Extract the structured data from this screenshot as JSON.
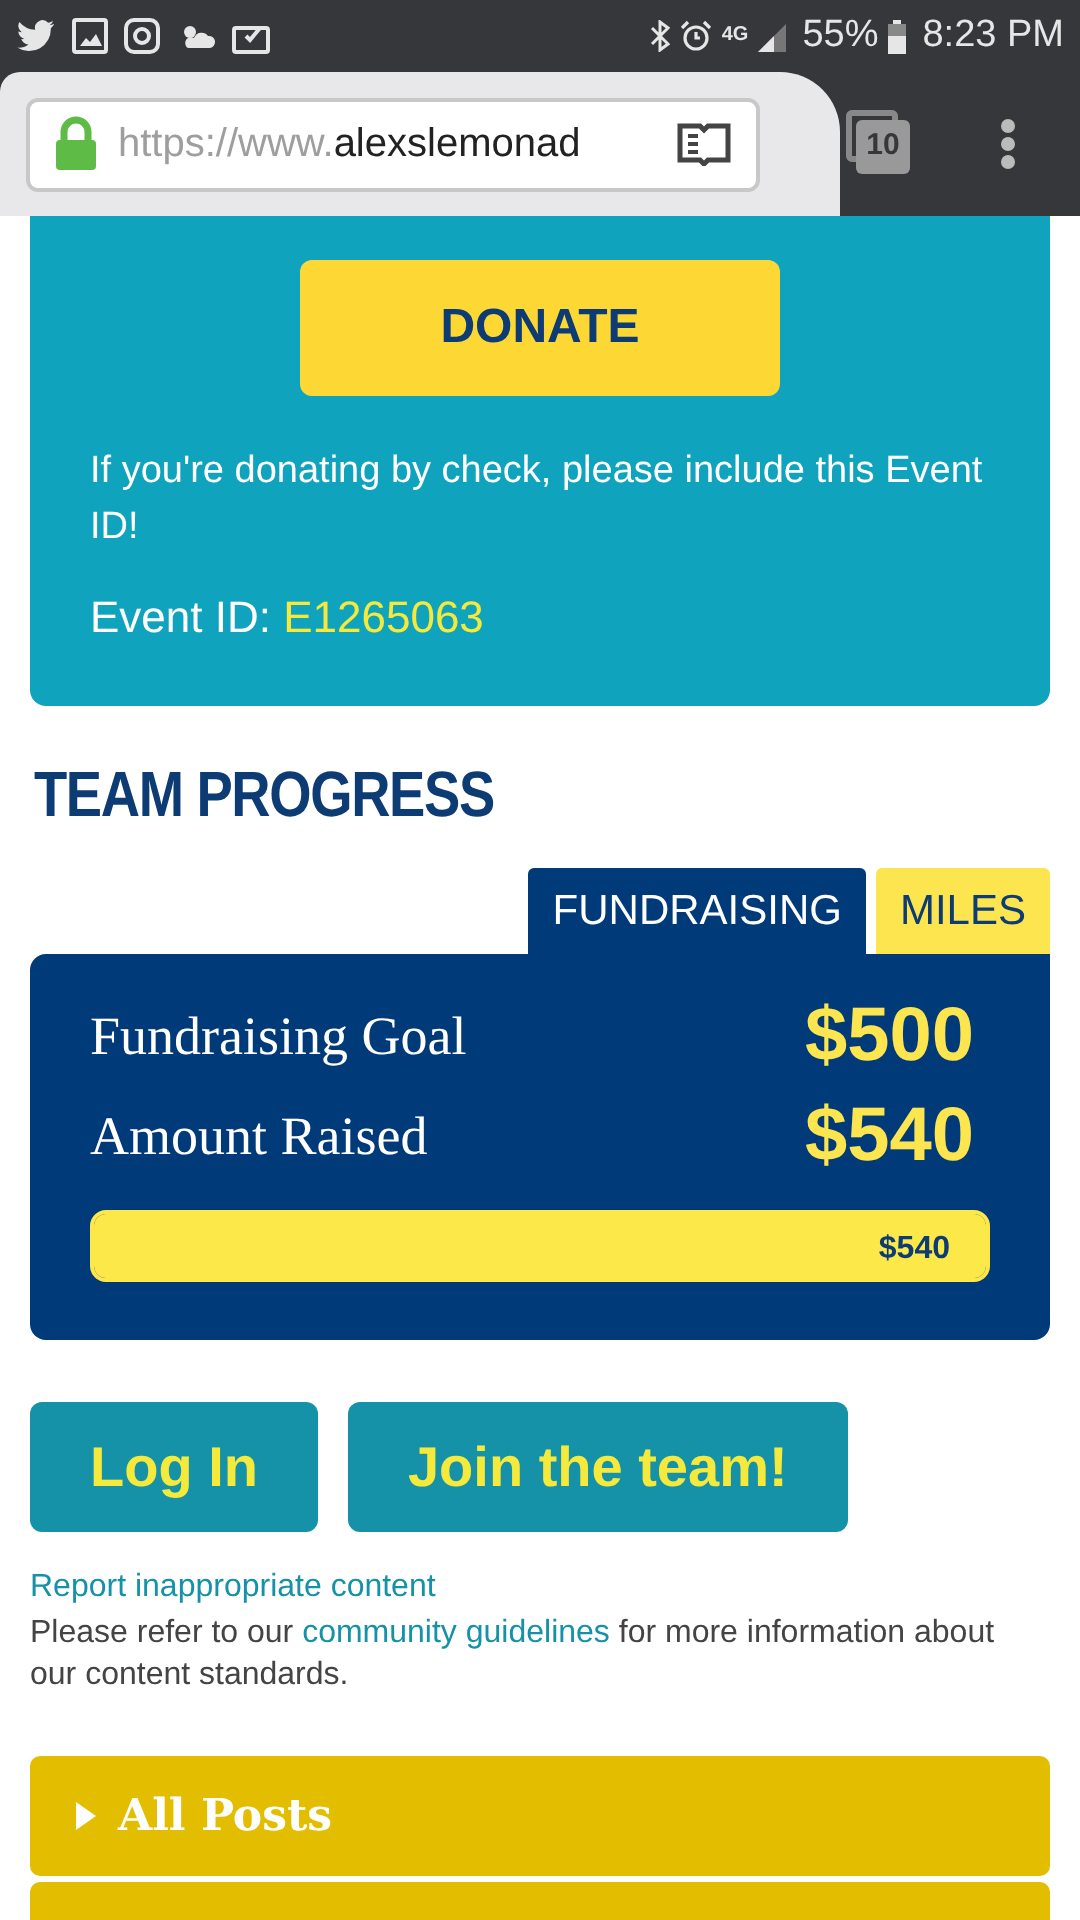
{
  "status_bar": {
    "network": "4G",
    "battery": "55%",
    "time": "8:23 PM"
  },
  "browser": {
    "url_scheme": "https://www.",
    "url_host": "alexslemonad",
    "tab_count": "10"
  },
  "donate_card": {
    "button": "DONATE",
    "note": "If you're donating by check, please include this Event ID!",
    "event_label": "Event ID:",
    "event_id": "E1265063"
  },
  "team_progress": {
    "title": "TEAM PROGRESS",
    "tabs": [
      {
        "label": "FUNDRAISING",
        "selected": true
      },
      {
        "label": "MILES",
        "selected": false
      }
    ],
    "rows": [
      {
        "label": "Fundraising Goal",
        "value": "$500"
      },
      {
        "label": "Amount Raised",
        "value": "$540"
      }
    ],
    "progress": {
      "level": 1,
      "reading": "$540"
    }
  },
  "buttons": [
    "Log In",
    "Join the team!"
  ],
  "report_link": "Report inappropriate content",
  "guidelines": {
    "before": "Please refer to our",
    "link": "community guidelines",
    "after": "for more information about our content standards."
  },
  "sections": [
    {
      "label": "All Posts",
      "expanded": false
    }
  ]
}
